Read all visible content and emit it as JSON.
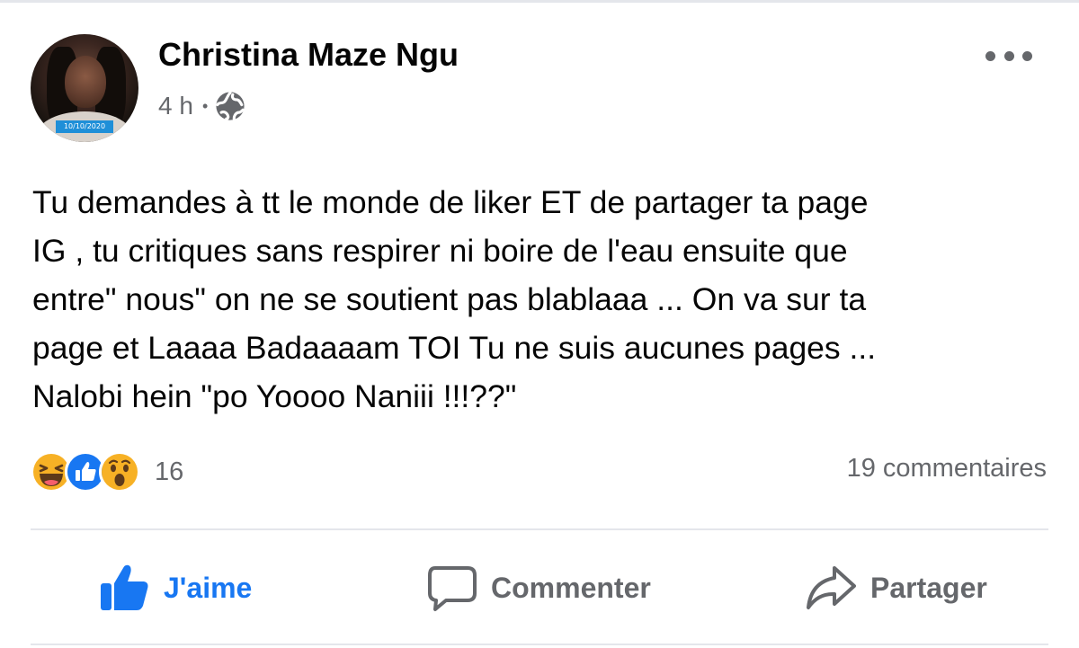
{
  "post": {
    "author": {
      "name": "Christina Maze Ngu",
      "avatar_date": "10/10/2020"
    },
    "timestamp": "4 h",
    "separator": "•",
    "privacy_icon": "globe-icon",
    "menu_icon": "more-options-icon",
    "text": "Tu demandes à tt le monde de liker ET de partager ta page\nIG , tu critiques sans respirer ni boire de l'eau ensuite que\nentre\" nous\" on ne se soutient pas blablaaa ...  On va sur ta\npage et Laaaa Badaaaam TOI Tu ne suis aucunes pages ...\nNalobi hein \"po Yoooo Naniii !!!??\"",
    "reactions": {
      "types": [
        "haha",
        "like",
        "wow"
      ],
      "count": "16"
    },
    "comments_count": "19 commentaires",
    "actions": {
      "like_label": "J'aime",
      "comment_label": "Commenter",
      "share_label": "Partager"
    },
    "colors": {
      "accent": "#1877f2",
      "secondary_text": "#65676b",
      "divider": "#e4e6eb",
      "reaction_yellow": "#f7b125"
    }
  }
}
